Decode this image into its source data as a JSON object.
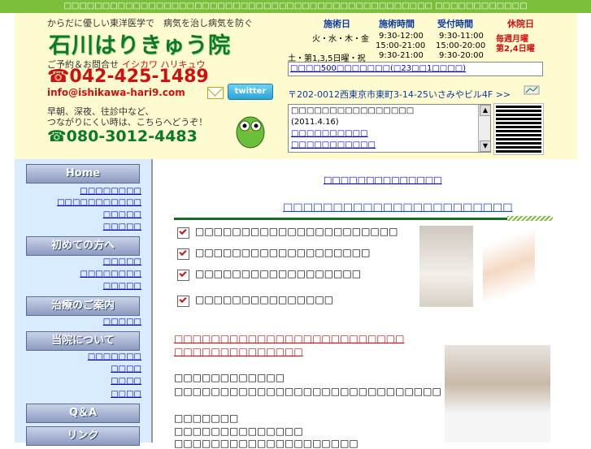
{
  "topbar": {
    "text": "□□□□□□□□□□□□□□□□□□□□□□□□□□□□□□□□□□□□□□□□□□□□□□□□ □□□□□□□□□□□□"
  },
  "header": {
    "tagline": "からだに優しい東洋医学で　病気を治し病気を防ぐ",
    "title": "石川はりきゅう院",
    "contact_label": "ご予約＆お問合せ",
    "contact_kana": "イシカワ ハリキュウ",
    "phone": "☎042-425-1489",
    "email": "info@ishikawa-hari9.com",
    "twitter_label": "twitter",
    "consult_line1": "早朝、深夜、往診中など、",
    "consult_line2": "つながりにくい時は、こちらへどうぞ！",
    "mobile": "☎080-3012-4483"
  },
  "hours": {
    "headers": [
      "施術日",
      "施術時間",
      "受付時間",
      "休院日"
    ],
    "rows": [
      {
        "day": "火・水・木・金",
        "time1": "9:30-12:00",
        "recv1": "9:30-11:00",
        "time2": "15:00-21:00",
        "recv2": "15:00-20:00"
      },
      {
        "day": "土・第1,3,5日曜・祝",
        "time1": "9:30-21:00",
        "recv1": "9:30-20:00"
      }
    ],
    "closed1": "毎週月曜",
    "closed2": "第2,4日曜"
  },
  "notice": "□□□□500□□□□□□□(□23□□1□□□□)",
  "address": "〒202-0012西東京市東町3-14-25いさみやビル4F >>",
  "news": {
    "lines": [
      "□□□□□□□□□□□□□□□□",
      "(2011.4.16)",
      "□□□□□□□□□□",
      "□□□□□□□□□□□"
    ]
  },
  "sidebar": {
    "buttons": [
      "Home",
      "初めての方へ",
      "治療のご案内",
      "当院について",
      "Q＆A",
      "リンク"
    ],
    "links": {
      "home": [
        "□□□□□□□□",
        "□□□□□□□□□□□",
        "□□□□□",
        "□□□□□"
      ],
      "first": [
        "□□□□□",
        "□□□□□□□□",
        "□□□□□"
      ],
      "treatment": [
        "□□□□□"
      ],
      "about": [
        "□□□□□□□",
        "□□□□",
        "□□□□",
        "□□□□"
      ]
    }
  },
  "content": {
    "top_link": "□□□□□□□□□□□□□□",
    "heading": "□□□□□□□□□□□□□□□□□□□□□□□",
    "items": [
      "□□□□□□□□□□□□□□□□□□□□□□",
      "□□□□□□□□□□□□□□□□□□□",
      "□□□□□□□□□□□□□□□□□□",
      "□□□□□□□□□□□□□□□"
    ],
    "red1": "□□□□□□□□□□□□□□□□□□□□□□□□□",
    "red2": "□□□□□□□□□□□□□□",
    "text1": "□□□□□□□□□□□□",
    "text2": "□□□□□□□□□□□□□□□□□□□□□□□□□□□□□",
    "text3": "□□□□□□□",
    "text4": "□□□□□□□□□□□□□□",
    "text5": "□□□□□□□□□□□□□□□□□□□□"
  }
}
